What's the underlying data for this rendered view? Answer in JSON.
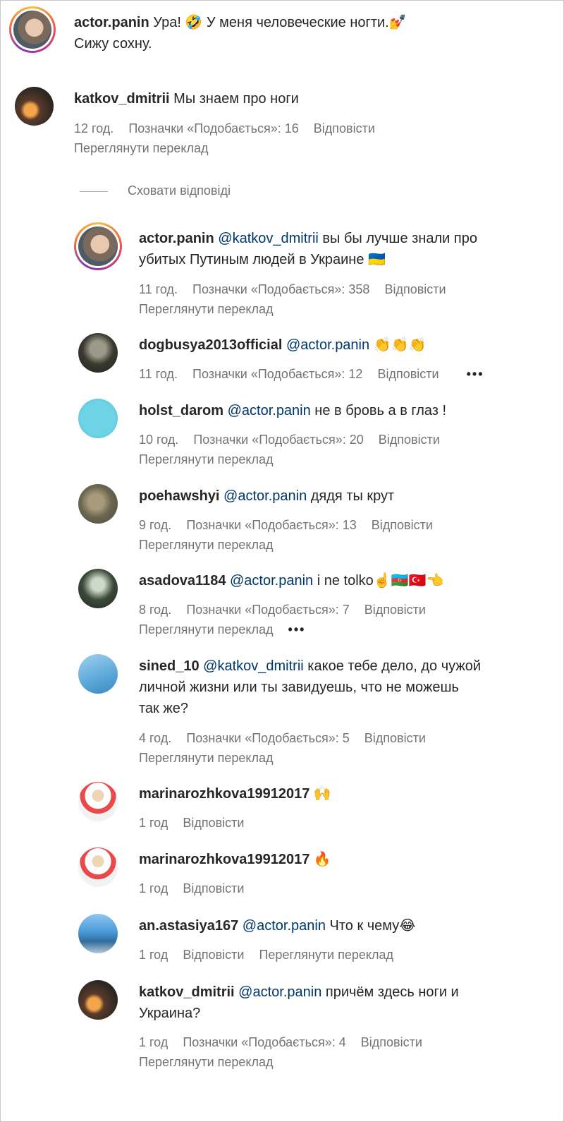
{
  "post": {
    "username": "actor.panin",
    "text_line1": "Ура! 🤣 У меня человеческие ногти.💅",
    "text_line2": "Сижу сохну."
  },
  "comment": {
    "username": "katkov_dmitrii",
    "text": "Мы знаем про ноги",
    "time": "12 год.",
    "likes": "Позначки «Подобається»: 16",
    "reply": "Відповісти",
    "translate": "Переглянути переклад"
  },
  "hide_replies": "Сховати відповіді",
  "replies": [
    {
      "username": "actor.panin",
      "mention": "@katkov_dmitrii",
      "text1": " вы бы лучше знали про",
      "text2": "убитых Путиным людей в Украине 🇺🇦",
      "time": "11 год.",
      "likes": "Позначки «Подобається»: 358",
      "reply": "Відповісти",
      "translate": "Переглянути переклад"
    },
    {
      "username": "dogbusya2013official",
      "mention": "@actor.panin",
      "text1": " 👏👏👏",
      "time": "11 год.",
      "likes": "Позначки «Подобається»: 12",
      "reply": "Відповісти",
      "more": "•••"
    },
    {
      "username": "holst_darom",
      "mention": "@actor.panin",
      "text1": " не в бровь а в глаз !",
      "time": "10 год.",
      "likes": "Позначки «Подобається»: 20",
      "reply": "Відповісти",
      "translate": "Переглянути переклад"
    },
    {
      "username": "poehawshyi",
      "mention": "@actor.panin",
      "text1": " дядя ты крут",
      "time": "9 год.",
      "likes": "Позначки «Подобається»: 13",
      "reply": "Відповісти",
      "translate": "Переглянути переклад"
    },
    {
      "username": "asadova1184",
      "mention": "@actor.panin",
      "text1": " i ne tolko☝️🇦🇿🇹🇷👈",
      "time": "8 год.",
      "likes": "Позначки «Подобається»: 7",
      "reply": "Відповісти",
      "translate": "Переглянути переклад",
      "more": "•••"
    },
    {
      "username": "sined_10",
      "mention": "@katkov_dmitrii",
      "text1": " какое тебе дело, до чужой",
      "text2": "личной жизни или ты завидуешь, что не можешь",
      "text3": "так же?",
      "time": "4 год.",
      "likes": "Позначки «Подобається»: 5",
      "reply": "Відповісти",
      "translate": "Переглянути переклад"
    },
    {
      "username": "marinarozhkova19912017",
      "text1": " 🙌",
      "time": "1 год",
      "reply": "Відповісти"
    },
    {
      "username": "marinarozhkova19912017",
      "text1": " 🔥",
      "time": "1 год",
      "reply": "Відповісти"
    },
    {
      "username": "an.astasiya167",
      "mention": "@actor.panin",
      "text1": " Что к чему😂",
      "time": "1 год",
      "reply": "Відповісти",
      "translate": "Переглянути переклад"
    },
    {
      "username": "katkov_dmitrii",
      "mention": "@actor.panin",
      "text1": " причём здесь ноги и",
      "text2": "Украина?",
      "time": "1 год",
      "likes": "Позначки «Подобається»: 4",
      "reply": "Відповісти",
      "translate": "Переглянути переклад"
    }
  ]
}
